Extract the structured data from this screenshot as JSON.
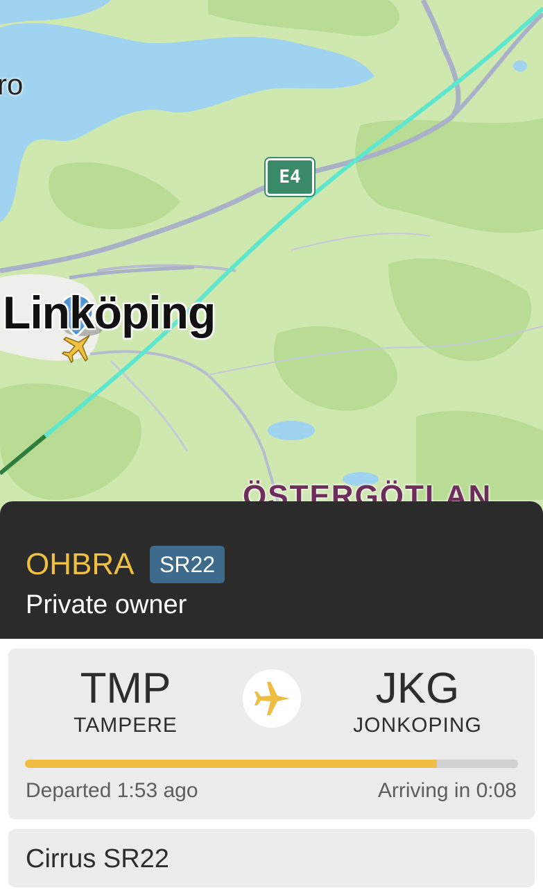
{
  "map": {
    "city_main": "Linköping",
    "city_partial": "ro",
    "region_partial": "ÖSTERGÖTLAN",
    "road_shield": "E4",
    "colors": {
      "land": "#cfe8b0",
      "forest": "#b8dc94",
      "water": "#9fd3ef",
      "road": "#b8bccf",
      "track": "#5fe6cf",
      "track_old": "#2e7d3f"
    },
    "icons": {
      "location_pin": "location-pin-icon",
      "aircraft": "aircraft-icon"
    }
  },
  "flight": {
    "callsign": "OHBRA",
    "type_code": "SR22",
    "owner": "Private owner"
  },
  "route": {
    "from_code": "TMP",
    "from_city": "TAMPERE",
    "to_code": "JKG",
    "to_city": "JONKOPING",
    "progress": 0.835,
    "departed": "Departed 1:53 ago",
    "arriving": "Arriving in 0:08",
    "accent": "#efbd43"
  },
  "aircraft": {
    "name": "Cirrus SR22"
  }
}
